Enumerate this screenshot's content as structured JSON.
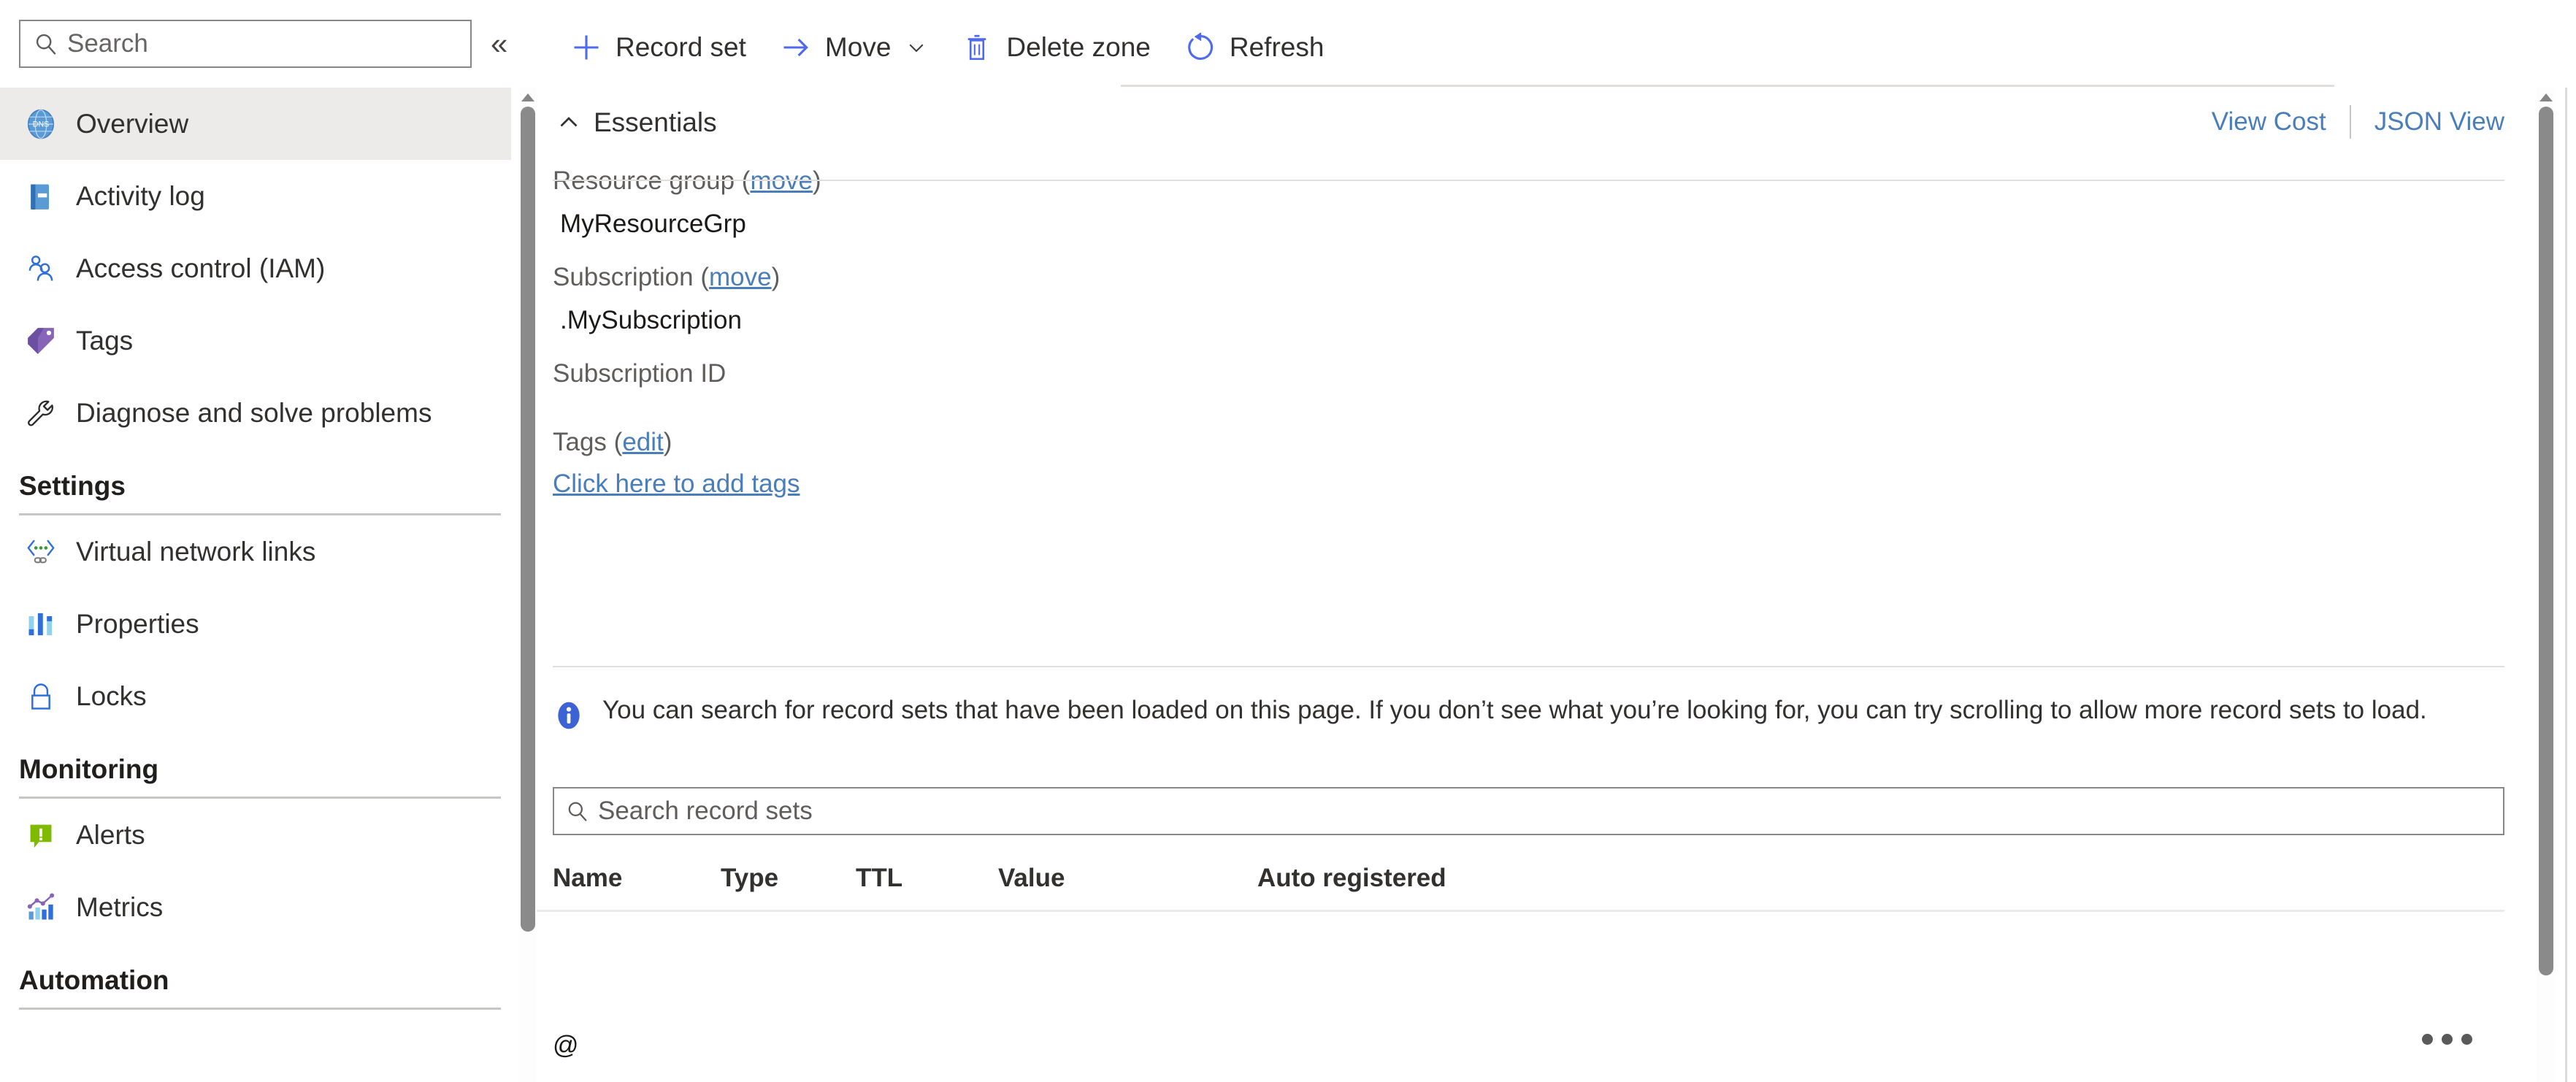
{
  "sidebar": {
    "search": {
      "placeholder": "Search",
      "icon": "search-icon"
    },
    "collapse_label": "«",
    "items": [
      {
        "label": "Overview",
        "icon": "dns-zone-icon",
        "selected": true
      },
      {
        "label": "Activity log",
        "icon": "activity-log-icon",
        "selected": false
      },
      {
        "label": "Access control (IAM)",
        "icon": "access-control-icon",
        "selected": false
      },
      {
        "label": "Tags",
        "icon": "tag-icon",
        "selected": false
      },
      {
        "label": "Diagnose and solve problems",
        "icon": "wrench-icon",
        "selected": false
      }
    ],
    "groups": [
      {
        "title": "Settings",
        "items": [
          {
            "label": "Virtual network links",
            "icon": "virtual-network-link-icon"
          },
          {
            "label": "Properties",
            "icon": "properties-icon"
          },
          {
            "label": "Locks",
            "icon": "lock-icon"
          }
        ]
      },
      {
        "title": "Monitoring",
        "items": [
          {
            "label": "Alerts",
            "icon": "alerts-icon"
          },
          {
            "label": "Metrics",
            "icon": "metrics-icon"
          }
        ]
      },
      {
        "title": "Automation",
        "items": []
      }
    ]
  },
  "toolbar": {
    "buttons": [
      {
        "label": "Record set",
        "icon": "plus-icon",
        "has_chevron": false
      },
      {
        "label": "Move",
        "icon": "arrow-right-icon",
        "has_chevron": true
      },
      {
        "label": "Delete zone",
        "icon": "trash-icon",
        "has_chevron": false
      },
      {
        "label": "Refresh",
        "icon": "refresh-icon",
        "has_chevron": false
      }
    ]
  },
  "essentials": {
    "title": "Essentials",
    "caret_icon": "chevron-up-icon",
    "view_cost_label": "View Cost",
    "json_view_label": "JSON View",
    "fields": [
      {
        "key": "Resource group",
        "link": "move",
        "value": "MyResourceGrp"
      },
      {
        "key": "Subscription",
        "link": "move",
        "value": ".MySubscription"
      },
      {
        "key": "Subscription ID",
        "link": "",
        "value": ""
      }
    ],
    "tags": {
      "key": "Tags",
      "link": "edit",
      "add_link": "Click here to add tags"
    }
  },
  "info_banner": {
    "icon": "info-icon",
    "text": "You can search for record sets that have been loaded on this page. If you don’t see what you’re looking for, you can try scrolling to allow more record sets to load."
  },
  "record_search": {
    "placeholder": "Search record sets",
    "icon": "search-icon"
  },
  "record_table": {
    "columns": [
      "Name",
      "Type",
      "TTL",
      "Value",
      "Auto registered"
    ],
    "rows": [
      {
        "name": "@",
        "type": "",
        "ttl": "",
        "value": "",
        "auto_registered": "",
        "menu_icon": "more-actions-icon"
      }
    ]
  },
  "colors": {
    "accent_link": "#4a7ebb",
    "toolbar_icon": "#4f6bed",
    "selected_row_bg": "#edebe9",
    "text_primary": "#1b1a19",
    "text_secondary": "#605e5c",
    "scrollbar": "#8a8a8a"
  }
}
